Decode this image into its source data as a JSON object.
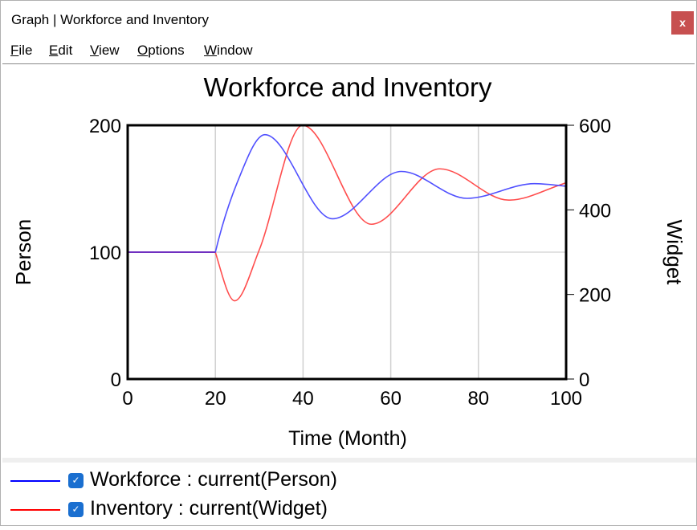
{
  "window": {
    "title": "Graph | Workforce and Inventory",
    "close_label": "x"
  },
  "menu": [
    {
      "accel": "F",
      "rest": "ile"
    },
    {
      "accel": "E",
      "rest": "dit"
    },
    {
      "accel": "V",
      "rest": "iew"
    },
    {
      "accel": "O",
      "rest": "ptions"
    },
    {
      "accel": "W",
      "rest": "indow"
    }
  ],
  "chart_data": {
    "type": "line",
    "title": "Workforce and Inventory",
    "xlabel": "Time (Month)",
    "ylabel": "Person",
    "y2label": "Widget",
    "xlim": [
      0,
      100
    ],
    "ylim": [
      0,
      200
    ],
    "y2lim": [
      0,
      600
    ],
    "xticks": [
      "0",
      "20",
      "40",
      "60",
      "80",
      "100"
    ],
    "yticks": [
      "0",
      "100",
      "200"
    ],
    "y2ticks": [
      "0",
      "200",
      "400",
      "600"
    ],
    "grid": true,
    "series": [
      {
        "name": "Workforce : current(Person)",
        "axis": "left",
        "color": "#5050ff",
        "legend_color": "#0000ff",
        "x": [
          0,
          20,
          25,
          31.3,
          46.7,
          62.4,
          77.4,
          92.8,
          100
        ],
        "y": [
          100,
          100,
          155,
          192.6,
          126.3,
          163.6,
          142.4,
          154,
          152
        ]
      },
      {
        "name": "Inventory : current(Widget)",
        "axis": "right",
        "color": "#ff4d4d",
        "legend_color": "#ff0000",
        "x": [
          0,
          20,
          24.4,
          30,
          39.9,
          55.6,
          71.2,
          86.9,
          100
        ],
        "y": [
          300,
          300,
          185,
          305,
          600,
          366,
          497,
          423,
          464
        ]
      }
    ]
  },
  "legend": [
    {
      "label": "Workforce : current(Person)",
      "checked": true
    },
    {
      "label": "Inventory : current(Widget)",
      "checked": true
    }
  ]
}
